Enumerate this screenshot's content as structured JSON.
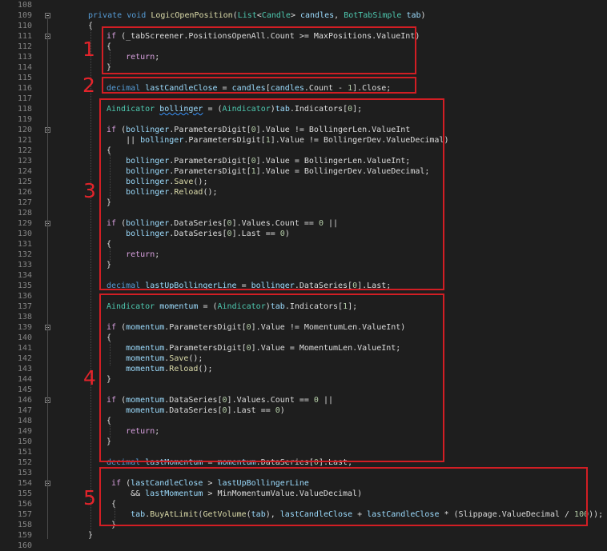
{
  "colors": {
    "background": "#1e1e1e",
    "keyword": "#569cd6",
    "type": "#4ec9b0",
    "method": "#dcdcaa",
    "identifier": "#9cdcfe",
    "number": "#b5cea8",
    "control": "#d8a0df",
    "annotation": "#d21e24"
  },
  "lines": [
    {
      "n": "108",
      "tokens": []
    },
    {
      "n": "109",
      "tokens": [
        {
          "t": "private",
          "c": "k"
        },
        {
          "t": " "
        },
        {
          "t": "void",
          "c": "k"
        },
        {
          "t": " "
        },
        {
          "t": "LogicOpenPosition",
          "c": "m"
        },
        {
          "t": "("
        },
        {
          "t": "List",
          "c": "t"
        },
        {
          "t": "<"
        },
        {
          "t": "Candle",
          "c": "t"
        },
        {
          "t": "> "
        },
        {
          "t": "candles",
          "c": "v"
        },
        {
          "t": ", "
        },
        {
          "t": "BotTabSimple",
          "c": "t"
        },
        {
          "t": " "
        },
        {
          "t": "tab",
          "c": "v"
        },
        {
          "t": ")"
        }
      ]
    },
    {
      "n": "110",
      "tokens": [
        {
          "t": "{"
        }
      ]
    },
    {
      "n": "111",
      "tokens": [
        {
          "t": "if",
          "c": "c"
        },
        {
          "t": " (_tabScreener.PositionsOpenAll.Count >= MaxPositions.ValueInt)"
        }
      ]
    },
    {
      "n": "112",
      "tokens": [
        {
          "t": "{"
        }
      ]
    },
    {
      "n": "113",
      "tokens": [
        {
          "t": "    "
        },
        {
          "t": "return",
          "c": "c"
        },
        {
          "t": ";"
        }
      ]
    },
    {
      "n": "114",
      "tokens": [
        {
          "t": "}"
        }
      ]
    },
    {
      "n": "115",
      "tokens": []
    },
    {
      "n": "116",
      "tokens": [
        {
          "t": "decimal",
          "c": "k"
        },
        {
          "t": " "
        },
        {
          "t": "lastCandleClose",
          "c": "v"
        },
        {
          "t": " = "
        },
        {
          "t": "candles",
          "c": "v"
        },
        {
          "t": "["
        },
        {
          "t": "candles",
          "c": "v"
        },
        {
          "t": ".Count - "
        },
        {
          "t": "1",
          "c": "n"
        },
        {
          "t": "].Close;"
        }
      ]
    },
    {
      "n": "117",
      "tokens": []
    },
    {
      "n": "118",
      "tokens": [
        {
          "t": "Aindicator",
          "c": "t"
        },
        {
          "t": " "
        },
        {
          "t": "bollinger",
          "c": "v",
          "sq": true
        },
        {
          "t": " = ("
        },
        {
          "t": "Aindicator",
          "c": "t"
        },
        {
          "t": ")"
        },
        {
          "t": "tab",
          "c": "v"
        },
        {
          "t": ".Indicators["
        },
        {
          "t": "0",
          "c": "n"
        },
        {
          "t": "];"
        }
      ]
    },
    {
      "n": "119",
      "tokens": []
    },
    {
      "n": "120",
      "tokens": [
        {
          "t": "if",
          "c": "c"
        },
        {
          "t": " ("
        },
        {
          "t": "bollinger",
          "c": "v"
        },
        {
          "t": ".ParametersDigit["
        },
        {
          "t": "0",
          "c": "n"
        },
        {
          "t": "].Value != BollingerLen.ValueInt"
        }
      ]
    },
    {
      "n": "121",
      "tokens": [
        {
          "t": "    || "
        },
        {
          "t": "bollinger",
          "c": "v"
        },
        {
          "t": ".ParametersDigit["
        },
        {
          "t": "1",
          "c": "n"
        },
        {
          "t": "].Value != BollingerDev.ValueDecimal)"
        }
      ]
    },
    {
      "n": "122",
      "tokens": [
        {
          "t": "{"
        }
      ]
    },
    {
      "n": "123",
      "tokens": [
        {
          "t": "    "
        },
        {
          "t": "bollinger",
          "c": "v"
        },
        {
          "t": ".ParametersDigit["
        },
        {
          "t": "0",
          "c": "n"
        },
        {
          "t": "].Value = BollingerLen.ValueInt;"
        }
      ]
    },
    {
      "n": "124",
      "tokens": [
        {
          "t": "    "
        },
        {
          "t": "bollinger",
          "c": "v"
        },
        {
          "t": ".ParametersDigit["
        },
        {
          "t": "1",
          "c": "n"
        },
        {
          "t": "].Value = BollingerDev.ValueDecimal;"
        }
      ]
    },
    {
      "n": "125",
      "tokens": [
        {
          "t": "    "
        },
        {
          "t": "bollinger",
          "c": "v"
        },
        {
          "t": "."
        },
        {
          "t": "Save",
          "c": "m"
        },
        {
          "t": "();"
        }
      ]
    },
    {
      "n": "126",
      "tokens": [
        {
          "t": "    "
        },
        {
          "t": "bollinger",
          "c": "v"
        },
        {
          "t": "."
        },
        {
          "t": "Reload",
          "c": "m"
        },
        {
          "t": "();"
        }
      ]
    },
    {
      "n": "127",
      "tokens": [
        {
          "t": "}"
        }
      ]
    },
    {
      "n": "128",
      "tokens": []
    },
    {
      "n": "129",
      "tokens": [
        {
          "t": "if",
          "c": "c"
        },
        {
          "t": " ("
        },
        {
          "t": "bollinger",
          "c": "v"
        },
        {
          "t": ".DataSeries["
        },
        {
          "t": "0",
          "c": "n"
        },
        {
          "t": "].Values.Count == "
        },
        {
          "t": "0",
          "c": "n"
        },
        {
          "t": " ||"
        }
      ]
    },
    {
      "n": "130",
      "tokens": [
        {
          "t": "    "
        },
        {
          "t": "bollinger",
          "c": "v"
        },
        {
          "t": ".DataSeries["
        },
        {
          "t": "0",
          "c": "n"
        },
        {
          "t": "].Last == "
        },
        {
          "t": "0",
          "c": "n"
        },
        {
          "t": ")"
        }
      ]
    },
    {
      "n": "131",
      "tokens": [
        {
          "t": "{"
        }
      ]
    },
    {
      "n": "132",
      "tokens": [
        {
          "t": "    "
        },
        {
          "t": "return",
          "c": "c"
        },
        {
          "t": ";"
        }
      ]
    },
    {
      "n": "133",
      "tokens": [
        {
          "t": "}"
        }
      ]
    },
    {
      "n": "134",
      "tokens": []
    },
    {
      "n": "135",
      "tokens": [
        {
          "t": "decimal",
          "c": "k"
        },
        {
          "t": " "
        },
        {
          "t": "lastUpBollingerLine",
          "c": "v"
        },
        {
          "t": " = "
        },
        {
          "t": "bollinger",
          "c": "v"
        },
        {
          "t": ".DataSeries["
        },
        {
          "t": "0",
          "c": "n"
        },
        {
          "t": "].Last;"
        }
      ]
    },
    {
      "n": "136",
      "tokens": []
    },
    {
      "n": "137",
      "tokens": [
        {
          "t": "Aindicator",
          "c": "t"
        },
        {
          "t": " "
        },
        {
          "t": "momentum",
          "c": "v"
        },
        {
          "t": " = ("
        },
        {
          "t": "Aindicator",
          "c": "t"
        },
        {
          "t": ")"
        },
        {
          "t": "tab",
          "c": "v"
        },
        {
          "t": ".Indicators["
        },
        {
          "t": "1",
          "c": "n"
        },
        {
          "t": "];"
        }
      ]
    },
    {
      "n": "138",
      "tokens": []
    },
    {
      "n": "139",
      "tokens": [
        {
          "t": "if",
          "c": "c"
        },
        {
          "t": " ("
        },
        {
          "t": "momentum",
          "c": "v"
        },
        {
          "t": ".ParametersDigit["
        },
        {
          "t": "0",
          "c": "n"
        },
        {
          "t": "].Value != MomentumLen.ValueInt)"
        }
      ]
    },
    {
      "n": "140",
      "tokens": [
        {
          "t": "{"
        }
      ]
    },
    {
      "n": "141",
      "tokens": [
        {
          "t": "    "
        },
        {
          "t": "momentum",
          "c": "v"
        },
        {
          "t": ".ParametersDigit["
        },
        {
          "t": "0",
          "c": "n"
        },
        {
          "t": "].Value = MomentumLen.ValueInt;"
        }
      ]
    },
    {
      "n": "142",
      "tokens": [
        {
          "t": "    "
        },
        {
          "t": "momentum",
          "c": "v"
        },
        {
          "t": "."
        },
        {
          "t": "Save",
          "c": "m"
        },
        {
          "t": "();"
        }
      ]
    },
    {
      "n": "143",
      "tokens": [
        {
          "t": "    "
        },
        {
          "t": "momentum",
          "c": "v"
        },
        {
          "t": "."
        },
        {
          "t": "Reload",
          "c": "m"
        },
        {
          "t": "();"
        }
      ]
    },
    {
      "n": "144",
      "tokens": [
        {
          "t": "}"
        }
      ]
    },
    {
      "n": "145",
      "tokens": []
    },
    {
      "n": "146",
      "tokens": [
        {
          "t": "if",
          "c": "c"
        },
        {
          "t": " ("
        },
        {
          "t": "momentum",
          "c": "v"
        },
        {
          "t": ".DataSeries["
        },
        {
          "t": "0",
          "c": "n"
        },
        {
          "t": "].Values.Count == "
        },
        {
          "t": "0",
          "c": "n"
        },
        {
          "t": " ||"
        }
      ]
    },
    {
      "n": "147",
      "tokens": [
        {
          "t": "    "
        },
        {
          "t": "momentum",
          "c": "v"
        },
        {
          "t": ".DataSeries["
        },
        {
          "t": "0",
          "c": "n"
        },
        {
          "t": "].Last == "
        },
        {
          "t": "0",
          "c": "n"
        },
        {
          "t": ")"
        }
      ]
    },
    {
      "n": "148",
      "tokens": [
        {
          "t": "{"
        }
      ]
    },
    {
      "n": "149",
      "tokens": [
        {
          "t": "    "
        },
        {
          "t": "return",
          "c": "c"
        },
        {
          "t": ";"
        }
      ]
    },
    {
      "n": "150",
      "tokens": [
        {
          "t": "}"
        }
      ]
    },
    {
      "n": "151",
      "tokens": []
    },
    {
      "n": "152",
      "tokens": [
        {
          "t": "decimal",
          "c": "k"
        },
        {
          "t": " "
        },
        {
          "t": "lastMomentum",
          "c": "v"
        },
        {
          "t": " = "
        },
        {
          "t": "momentum",
          "c": "v"
        },
        {
          "t": ".DataSeries["
        },
        {
          "t": "0",
          "c": "n"
        },
        {
          "t": "].Last;"
        }
      ]
    },
    {
      "n": "153",
      "tokens": []
    },
    {
      "n": "154",
      "tokens": [
        {
          "t": "if",
          "c": "c"
        },
        {
          "t": " ("
        },
        {
          "t": "lastCandleClose",
          "c": "v"
        },
        {
          "t": " > "
        },
        {
          "t": "lastUpBollingerLine",
          "c": "v"
        }
      ]
    },
    {
      "n": "155",
      "tokens": [
        {
          "t": "    && "
        },
        {
          "t": "lastMomentum",
          "c": "v"
        },
        {
          "t": " > MinMomentumValue.ValueDecimal)"
        }
      ]
    },
    {
      "n": "156",
      "tokens": [
        {
          "t": "{"
        }
      ]
    },
    {
      "n": "157",
      "tokens": [
        {
          "t": "    "
        },
        {
          "t": "tab",
          "c": "v"
        },
        {
          "t": "."
        },
        {
          "t": "BuyAtLimit",
          "c": "m"
        },
        {
          "t": "("
        },
        {
          "t": "GetVolume",
          "c": "m"
        },
        {
          "t": "("
        },
        {
          "t": "tab",
          "c": "v"
        },
        {
          "t": "), "
        },
        {
          "t": "lastCandleClose",
          "c": "v"
        },
        {
          "t": " + "
        },
        {
          "t": "lastCandleClose",
          "c": "v"
        },
        {
          "t": " * (Slippage.ValueDecimal / "
        },
        {
          "t": "100",
          "c": "n"
        },
        {
          "t": "));"
        }
      ]
    },
    {
      "n": "158",
      "tokens": [
        {
          "t": "}"
        }
      ]
    },
    {
      "n": "159",
      "tokens": [
        {
          "t": "}"
        }
      ]
    },
    {
      "n": "160",
      "tokens": []
    }
  ],
  "annotations": [
    {
      "label": "1"
    },
    {
      "label": "2"
    },
    {
      "label": "3"
    },
    {
      "label": "4"
    },
    {
      "label": "5"
    }
  ]
}
